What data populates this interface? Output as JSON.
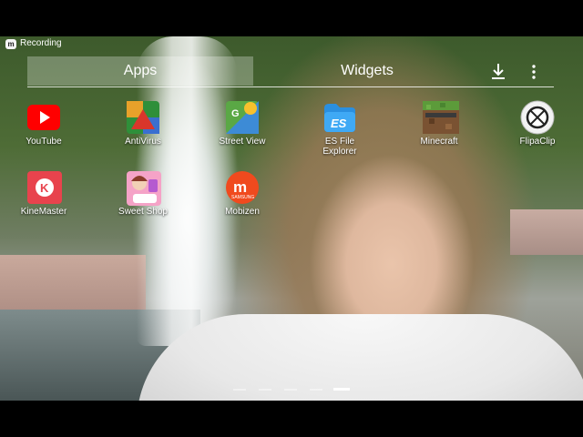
{
  "status_bar": {
    "recording_label": "Recording"
  },
  "tabs": [
    {
      "label": "Apps",
      "selected": true
    },
    {
      "label": "Widgets",
      "selected": false
    }
  ],
  "toolbar": {
    "store_icon": "download-icon",
    "menu_icon": "overflow-menu-icon"
  },
  "apps": [
    {
      "label": "YouTube",
      "icon": "youtube-icon"
    },
    {
      "label": "AntiVirus",
      "icon": "antivirus-icon"
    },
    {
      "label": "Street View",
      "icon": "street-view-icon"
    },
    {
      "label": "ES File\nExplorer",
      "icon": "es-file-explorer-icon"
    },
    {
      "label": "Minecraft",
      "icon": "minecraft-icon"
    },
    {
      "label": "FlipaClip",
      "icon": "flipaclip-icon"
    },
    {
      "label": "KineMaster",
      "icon": "kinemaster-icon"
    },
    {
      "label": "Sweet Shop",
      "icon": "sweet-shop-icon"
    },
    {
      "label": "Mobizen",
      "icon": "mobizen-icon"
    }
  ],
  "page_indicator": {
    "pages": 5,
    "current": 5
  },
  "colors": {
    "youtube_red": "#ff0000",
    "es_blue": "#2a8fe0",
    "kinemaster_red": "#e8434d",
    "mobizen_orange": "#f04a1e"
  }
}
